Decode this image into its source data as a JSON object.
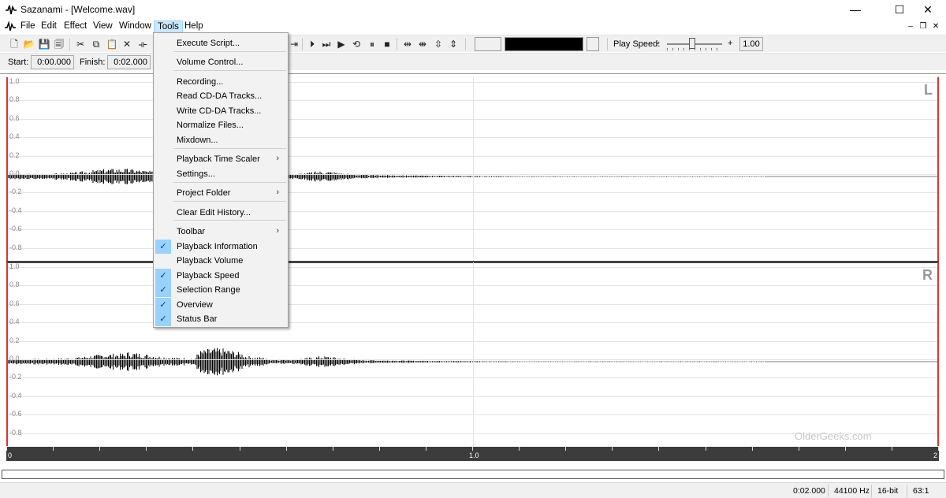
{
  "window": {
    "title": "Sazanami - [Welcome.wav]",
    "minimize": "—",
    "maximize": "☐",
    "close": "✕"
  },
  "menubar": {
    "items": [
      "File",
      "Edit",
      "Effect",
      "View",
      "Window",
      "Tools",
      "Help"
    ],
    "active": "Tools",
    "mdi": {
      "minimize": "–",
      "restore": "❐",
      "close": "✕"
    }
  },
  "tools_menu": {
    "items": [
      {
        "label": "Execute Script...",
        "submenu": false,
        "checked": false
      },
      {
        "label": "Volume Control...",
        "submenu": false,
        "checked": false
      },
      {
        "label": "Recording...",
        "submenu": false,
        "checked": false
      },
      {
        "label": "Read CD-DA Tracks...",
        "submenu": false,
        "checked": false
      },
      {
        "label": "Write CD-DA Tracks...",
        "submenu": false,
        "checked": false
      },
      {
        "label": "Normalize Files...",
        "submenu": false,
        "checked": false
      },
      {
        "label": "Mixdown...",
        "submenu": false,
        "checked": false
      },
      {
        "label": "Playback Time Scaler",
        "submenu": true,
        "checked": false
      },
      {
        "label": "Settings...",
        "submenu": false,
        "checked": false
      },
      {
        "label": "Project Folder",
        "submenu": true,
        "checked": false
      },
      {
        "label": "Clear Edit History...",
        "submenu": false,
        "checked": false
      },
      {
        "label": "Toolbar",
        "submenu": true,
        "checked": false
      },
      {
        "label": "Playback Information",
        "submenu": false,
        "checked": true
      },
      {
        "label": "Playback Volume",
        "submenu": false,
        "checked": false
      },
      {
        "label": "Playback Speed",
        "submenu": false,
        "checked": true
      },
      {
        "label": "Selection Range",
        "submenu": false,
        "checked": true
      },
      {
        "label": "Overview",
        "submenu": false,
        "checked": true
      },
      {
        "label": "Status Bar",
        "submenu": false,
        "checked": true
      }
    ]
  },
  "toolbar": {
    "play_speed_label": "Play Speed:",
    "play_speed_minus": "-",
    "play_speed_plus": "+",
    "play_speed_value": "1.00",
    "play_speed_level": 0.45,
    "colors": {
      "box1": "#f0f0f0",
      "box2": "#000000",
      "box3": "#f0f0f0"
    }
  },
  "selection": {
    "start_label": "Start:",
    "start_value": "0:00.000",
    "finish_label": "Finish:",
    "finish_value": "0:02.000"
  },
  "waveform": {
    "y_labels": [
      "1.0",
      "0.8",
      "0.6",
      "0.4",
      "0.2",
      "0.0",
      "-0.2",
      "-0.4",
      "-0.6",
      "-0.8"
    ],
    "channels": [
      "L",
      "R"
    ],
    "timeline_labels": [
      "0",
      "1.0",
      "2"
    ],
    "watermark": "OlderGeeks.com"
  },
  "statusbar": {
    "position": "0:02.000",
    "rate": "44100 Hz",
    "bits": "16-bit",
    "zoom": "63:1"
  }
}
